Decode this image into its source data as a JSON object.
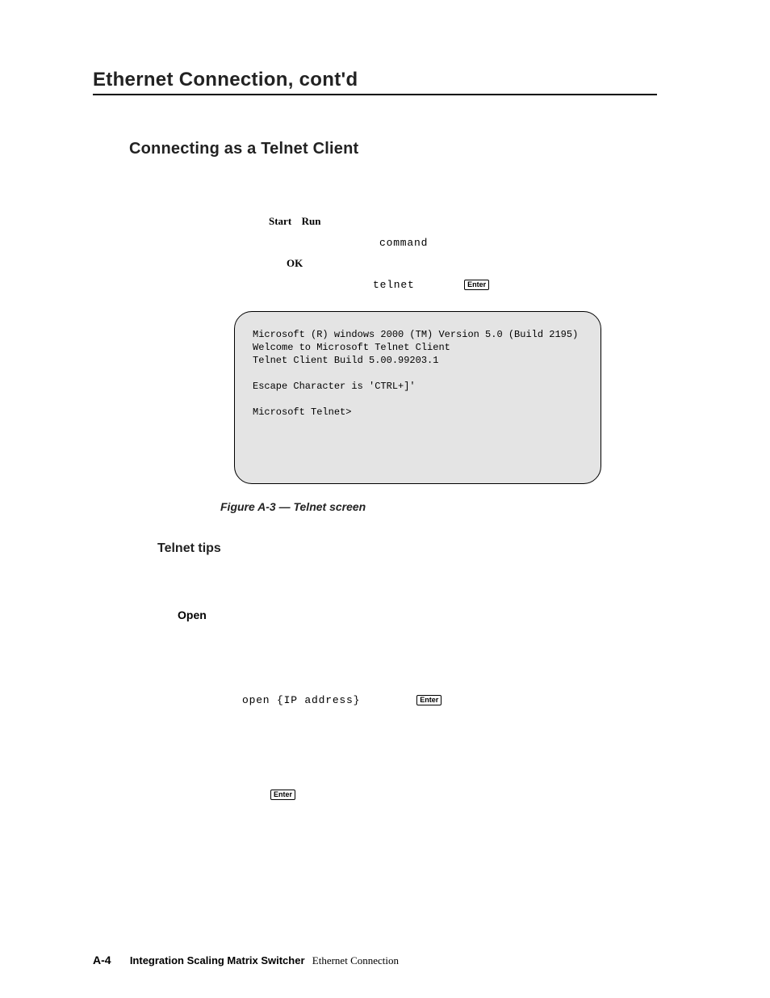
{
  "chapter_title": "Ethernet Connection, cont'd",
  "section_title": "Connecting as a Telnet Client",
  "terms": {
    "start": "Start",
    "run": "Run",
    "command": "command",
    "ok": "OK",
    "telnet": "telnet",
    "enter_label": "Enter"
  },
  "telnet_box": {
    "line1": "Microsoft (R) windows 2000 (TM) Version 5.0 (Build 2195)",
    "line2": "Welcome to Microsoft Telnet Client",
    "line3": "Telnet Client Build 5.00.99203.1",
    "line4": "Escape Character is 'CTRL+]'",
    "line5": "Microsoft Telnet>"
  },
  "figure_caption": "Figure A-3 — Telnet screen",
  "subsection_title": "Telnet tips",
  "open_label": "Open",
  "open_command": "open {IP address}",
  "footer": {
    "page_num": "A-4",
    "product": "Integration Scaling Matrix Switcher",
    "section": "Ethernet Connection"
  }
}
